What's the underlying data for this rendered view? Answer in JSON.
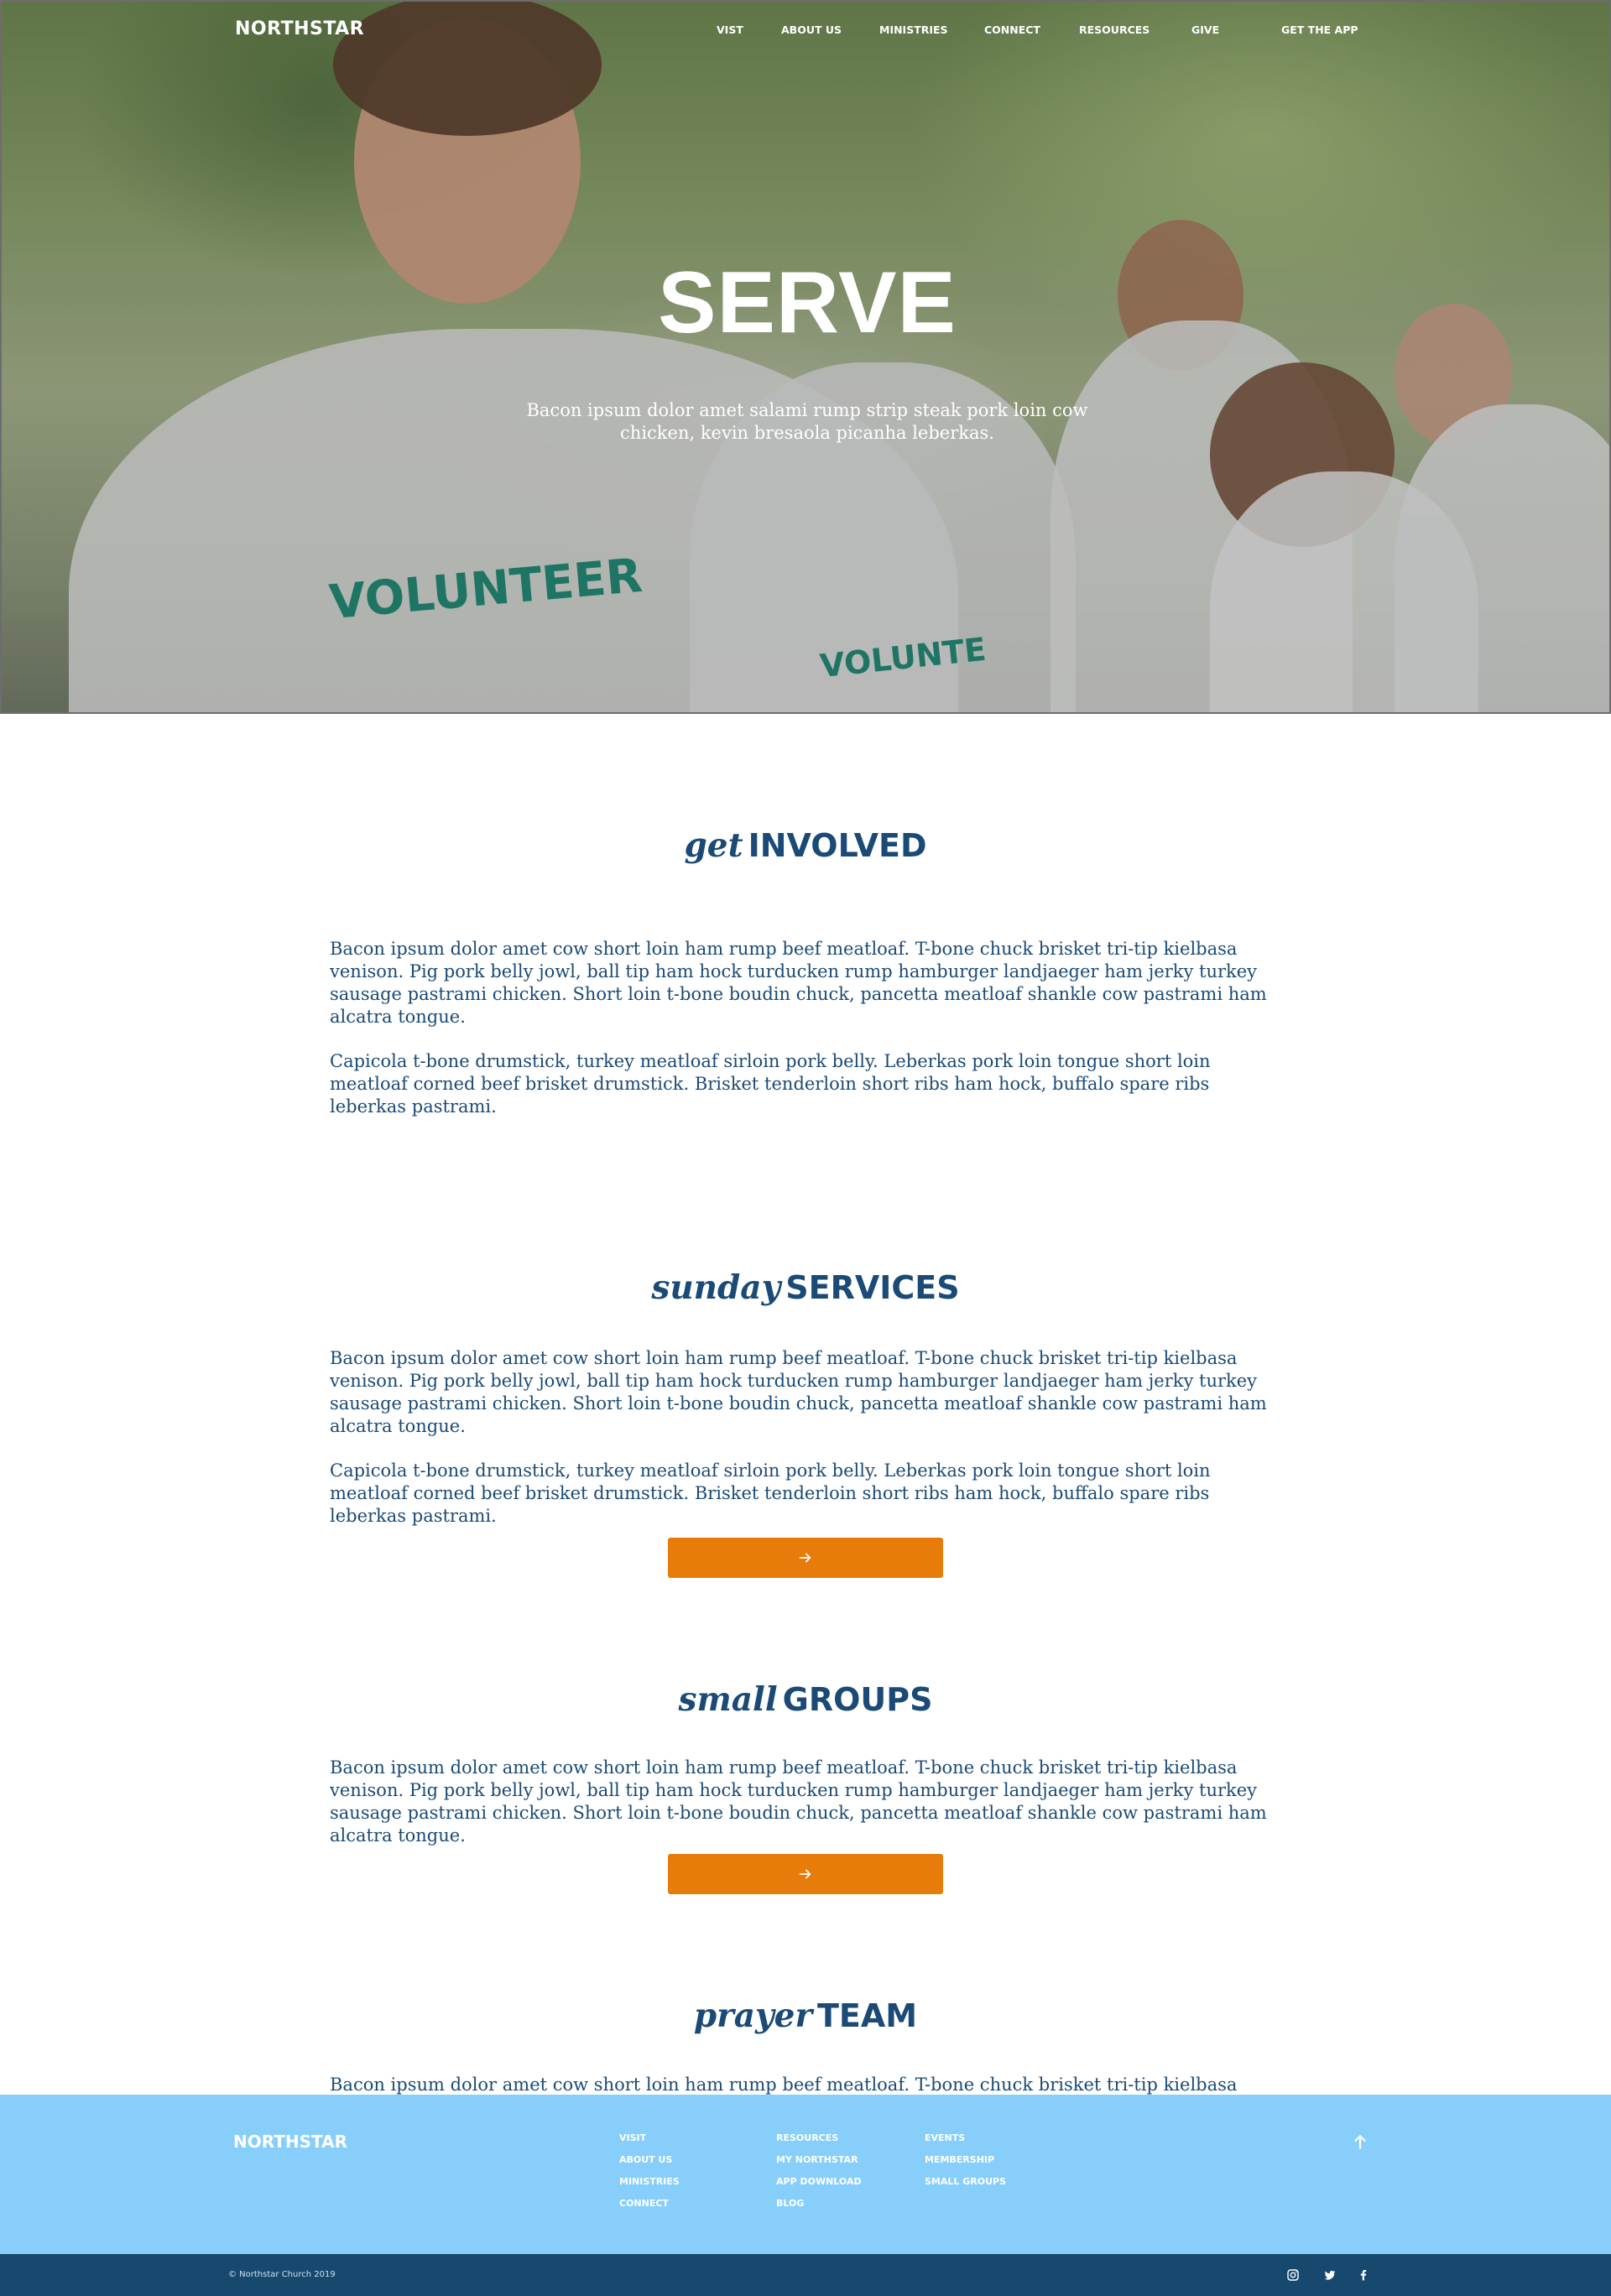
{
  "colors": {
    "brand_navy": "#1a4a75",
    "accent_orange": "#e77c0b",
    "footer_light_blue": "#87cffa",
    "footer_dark_blue": "#17486e"
  },
  "nav": {
    "brand": "NORTHSTAR",
    "items": [
      {
        "label": "VIST"
      },
      {
        "label": "ABOUT US"
      },
      {
        "label": "MINISTRIES"
      },
      {
        "label": "CONNECT"
      },
      {
        "label": "RESOURCES"
      },
      {
        "label": "GIVE"
      },
      {
        "label": "GET THE APP"
      }
    ]
  },
  "hero": {
    "title": "SERVE",
    "subtitle": "Bacon ipsum dolor amet salami rump strip steak pork loin cow chicken, kevin bresaola picanha leberkas.",
    "image_text": "VOLUNTEER",
    "image_text_2": "VOLUNTE"
  },
  "sections": {
    "get_involved": {
      "lead": "get",
      "strong": "INVOLVED",
      "paragraphs": [
        "Bacon ipsum dolor amet cow short loin ham rump beef meatloaf. T-bone chuck brisket tri-tip kielbasa venison. Pig pork belly jowl, ball tip ham hock turducken rump hamburger landjaeger ham jerky turkey sausage pastrami chicken. Short loin t-bone boudin chuck, pancetta meatloaf shankle cow pastrami ham alcatra tongue.",
        "Capicola t-bone drumstick, turkey meatloaf sirloin pork belly. Leberkas pork loin tongue short loin meatloaf corned beef brisket drumstick. Brisket tenderloin short ribs ham hock, buffalo spare ribs leberkas pastrami."
      ]
    },
    "sunday_services": {
      "lead": "sunday",
      "strong": "SERVICES",
      "paragraphs": [
        "Bacon ipsum dolor amet cow short loin ham rump beef meatloaf. T-bone chuck brisket tri-tip kielbasa venison. Pig pork belly jowl, ball tip ham hock turducken rump hamburger landjaeger ham jerky turkey sausage pastrami chicken. Short loin t-bone boudin chuck, pancetta meatloaf shankle cow pastrami ham alcatra tongue.",
        "Capicola t-bone drumstick, turkey meatloaf sirloin pork belly. Leberkas pork loin tongue short loin meatloaf corned beef brisket drumstick. Brisket tenderloin short ribs ham hock, buffalo spare ribs leberkas pastrami."
      ],
      "button_icon": "arrow-right-icon"
    },
    "small_groups": {
      "lead": "small",
      "strong": "GROUPS",
      "paragraphs": [
        "Bacon ipsum dolor amet cow short loin ham rump beef meatloaf. T-bone chuck brisket tri-tip kielbasa venison. Pig pork belly jowl, ball tip ham hock turducken rump hamburger landjaeger ham jerky turkey sausage pastrami chicken. Short loin t-bone boudin chuck, pancetta meatloaf shankle cow pastrami ham alcatra tongue."
      ],
      "button_icon": "arrow-right-icon"
    },
    "prayer_team": {
      "lead": "prayer",
      "strong": "TEAM",
      "paragraphs": [
        "Bacon ipsum dolor amet cow short loin ham rump beef meatloaf. T-bone chuck brisket tri-tip kielbasa"
      ]
    }
  },
  "footer": {
    "brand": "NORTHSTAR",
    "columns": [
      [
        "VISIT",
        "ABOUT US",
        "MINISTRIES",
        "CONNECT"
      ],
      [
        "RESOURCES",
        "MY NORTHSTAR",
        "APP DOWNLOAD",
        "BLOG"
      ],
      [
        "EVENTS",
        "MEMBERSHIP",
        "SMALL GROUPS"
      ]
    ],
    "to_top_icon": "arrow-up-icon",
    "copyright": "© Northstar Church 2019",
    "social": [
      "instagram-icon",
      "twitter-icon",
      "facebook-icon"
    ]
  }
}
